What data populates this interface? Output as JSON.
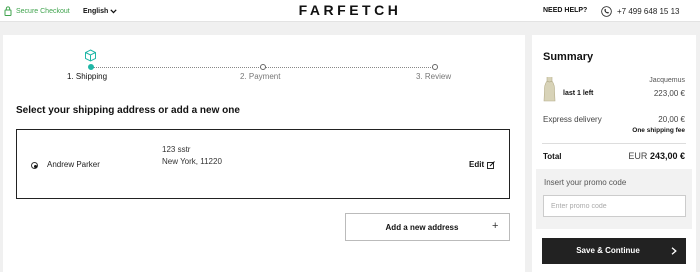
{
  "header": {
    "secure_label": "Secure Checkout",
    "language": "English",
    "logo": "FARFETCH",
    "help_label": "NEED HELP?",
    "phone": "+7 499 648 15 13",
    "icons": [
      "lock-icon",
      "chevron-down-icon",
      "phone-icon"
    ]
  },
  "steps": [
    {
      "label": "1. Shipping",
      "active": true
    },
    {
      "label": "2. Payment",
      "active": false
    },
    {
      "label": "3. Review",
      "active": false
    }
  ],
  "shipping": {
    "title": "Select your shipping address or add a new one",
    "address": {
      "name": "Andrew Parker",
      "line1": "123 sstr",
      "line2": "New York, 11220",
      "edit_label": "Edit",
      "selected": true
    },
    "add_label": "Add a new address",
    "add_icon": "+"
  },
  "summary": {
    "title": "Summary",
    "item": {
      "stock": "1 left",
      "stock_qty": "last",
      "brand": "Jacquemus",
      "price": "223,00 €"
    },
    "shipping_label": "Express delivery",
    "shipping_price": "20,00 €",
    "shipping_note": "One shipping fee",
    "total_label": "Total",
    "total_currency": "EUR",
    "total_value": "243,00 €",
    "promo_label": "Insert your promo code",
    "promo_placeholder": "Enter promo code",
    "cta_label": "Save & Continue"
  },
  "colors": {
    "accent": "#1fb6a6",
    "secure_green": "#3fa34d",
    "button_dark": "#222222",
    "page_bg": "#f0f0f0"
  }
}
